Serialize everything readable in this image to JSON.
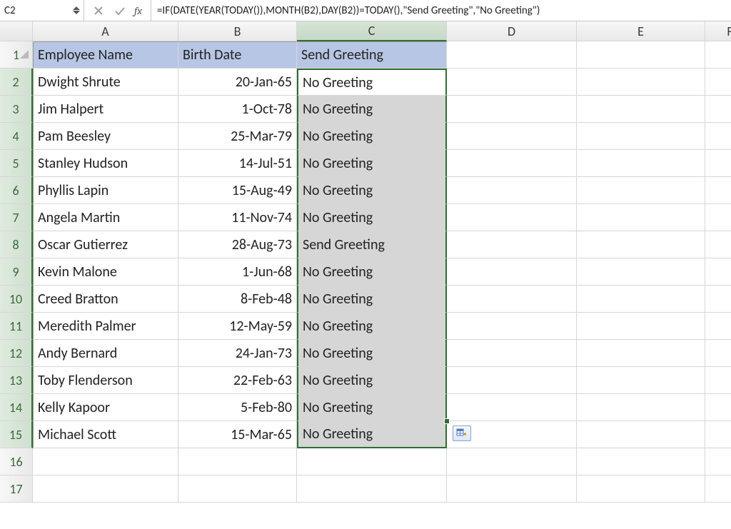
{
  "formula_bar": {
    "cell_ref": "C2",
    "formula": "=IF(DATE(YEAR(TODAY()),MONTH(B2),DAY(B2))=TODAY(),\"Send Greeting\",\"No Greeting\")"
  },
  "columns": [
    "A",
    "B",
    "C",
    "D",
    "E",
    "F"
  ],
  "row_numbers": [
    1,
    2,
    3,
    4,
    5,
    6,
    7,
    8,
    9,
    10,
    11,
    12,
    13,
    14,
    15,
    16,
    17
  ],
  "headers": {
    "A": "Employee Name",
    "B": "Birth Date",
    "C": "Send Greeting"
  },
  "rows": [
    {
      "A": "Dwight Shrute",
      "B": "20-Jan-65",
      "C": "No Greeting"
    },
    {
      "A": "Jim Halpert",
      "B": "1-Oct-78",
      "C": "No Greeting"
    },
    {
      "A": "Pam Beesley",
      "B": "25-Mar-79",
      "C": "No Greeting"
    },
    {
      "A": "Stanley Hudson",
      "B": "14-Jul-51",
      "C": "No Greeting"
    },
    {
      "A": "Phyllis Lapin",
      "B": "15-Aug-49",
      "C": "No Greeting"
    },
    {
      "A": "Angela Martin",
      "B": "11-Nov-74",
      "C": "No Greeting"
    },
    {
      "A": "Oscar Gutierrez",
      "B": "28-Aug-73",
      "C": "Send Greeting"
    },
    {
      "A": "Kevin Malone",
      "B": "1-Jun-68",
      "C": "No Greeting"
    },
    {
      "A": "Creed Bratton",
      "B": "8-Feb-48",
      "C": "No Greeting"
    },
    {
      "A": "Meredith Palmer",
      "B": "12-May-59",
      "C": "No Greeting"
    },
    {
      "A": "Andy Bernard",
      "B": "24-Jan-73",
      "C": "No Greeting"
    },
    {
      "A": "Toby Flenderson",
      "B": "22-Feb-63",
      "C": "No Greeting"
    },
    {
      "A": "Kelly Kapoor",
      "B": "5-Feb-80",
      "C": "No Greeting"
    },
    {
      "A": "Michael Scott",
      "B": "15-Mar-65",
      "C": "No Greeting"
    }
  ],
  "selection": {
    "active_cell": "C2",
    "range": "C2:C15",
    "selected_column": "C"
  }
}
